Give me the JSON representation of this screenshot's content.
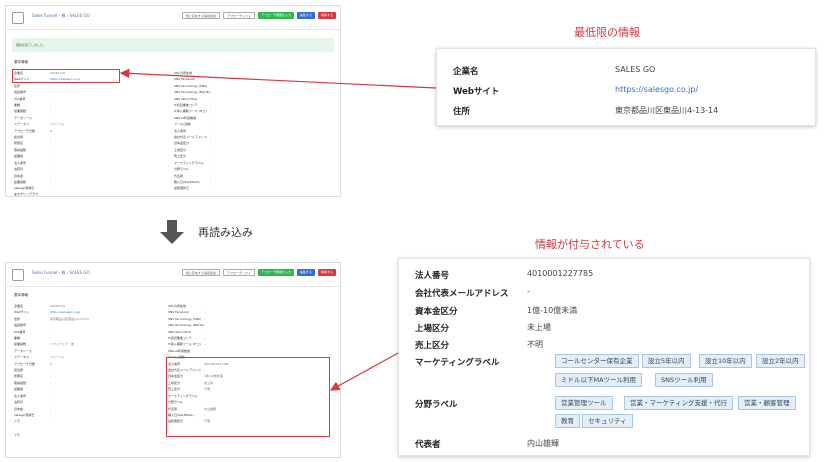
{
  "top_shot": {
    "crumb": "Sales Funnel › 株 › SALES GO",
    "buttons": [
      "既に存在する情報追加",
      "アプローチリスト",
      "アプローチ履歴を入力",
      "編集する",
      "削除する"
    ],
    "alert": "保存が完了しました。",
    "section": "基本情報",
    "left_rows": [
      [
        "企業名",
        "SALES GO"
      ],
      [
        "Webサイト",
        "https://salesgo.co.jp"
      ],
      [
        "住所",
        "-"
      ],
      [
        "電話番号",
        "-"
      ],
      [
        "FAX番号",
        "-"
      ],
      [
        "業種",
        "-"
      ],
      [
        "従業員数",
        "-"
      ],
      [
        "データソース",
        "-"
      ],
      [
        "ステータス",
        "フリー(ミ)"
      ],
      [
        "アプローチ日数",
        "0"
      ],
      [
        "担当者",
        "-"
      ],
      [
        "所属名",
        "-"
      ],
      [
        "取締役数",
        "-"
      ],
      [
        "従業員",
        "-"
      ],
      [
        "法人番号",
        "-"
      ],
      [
        "決算月",
        "-"
      ],
      [
        "資本金",
        "-"
      ],
      [
        "従業員数",
        "-"
      ],
      [
        "salesgo登録日",
        "-"
      ],
      [
        "メモ",
        "-"
      ]
    ],
    "right_rows": [
      [
        "URLの所在地",
        "-"
      ],
      [
        "SNS Facebook",
        "-"
      ],
      [
        "SNS Technology (SNS)",
        "-"
      ],
      [
        "SNS Technology (MarTe)",
        "-"
      ],
      [
        "SNS Yahoo/Hub",
        "-"
      ],
      [
        "IT投資推進コンテ",
        "-"
      ],
      [
        "IT導入補助ツール (ITコ)",
        "-"
      ],
      [
        "SNS-AI利用推進",
        "-"
      ],
      [
        "ツール(活動)",
        "-"
      ],
      [
        "法人番号",
        "-"
      ],
      [
        "会社代表メールアドレス",
        "-"
      ],
      [
        "資本金区分",
        "-"
      ],
      [
        "上場区分",
        "-"
      ],
      [
        "売上区分",
        "-"
      ],
      [
        "マーケティングラベル",
        "-"
      ],
      [
        "分野ラベル",
        "-"
      ],
      [
        "代表者",
        "-"
      ],
      [
        "購入日(SALESGO)",
        "-"
      ],
      [
        "最終更新日",
        "-"
      ]
    ],
    "footer": "オーダリングラマ"
  },
  "bottom_shot": {
    "crumb": "Sales Funnel › 株 › SALES GO",
    "buttons": [
      "既に存在する情報追加",
      "アプローチリスト",
      "アプローチ履歴を入力",
      "編集する",
      "削除する"
    ],
    "section": "基本情報",
    "left_rows": [
      [
        "企業名",
        "SALES GO"
      ],
      [
        "Webサイト",
        "https://salesgo.co.jp"
      ],
      [
        "住所",
        "東京都品川区東品川4-13-14"
      ],
      [
        "電話番号",
        "-"
      ],
      [
        "FAX番号",
        "-"
      ],
      [
        "業種",
        "-"
      ],
      [
        "従業員数",
        "ソフトウェア・他"
      ],
      [
        "データソース",
        "-"
      ],
      [
        "ステータス",
        "フリー(ミ)"
      ],
      [
        "アプローチ日数",
        "0"
      ],
      [
        "担当者",
        "-"
      ],
      [
        "所属名",
        "-"
      ],
      [
        "取締役数",
        "-"
      ],
      [
        "従業員",
        "-"
      ],
      [
        "法人番号",
        "-"
      ],
      [
        "決算月",
        "-"
      ],
      [
        "資本金",
        "-"
      ],
      [
        "salesgo登録日",
        "-"
      ],
      [
        "メモ",
        "-"
      ]
    ],
    "right_rows": [
      [
        "URLの所在地",
        "-"
      ],
      [
        "SNS Facebook",
        "-"
      ],
      [
        "SNS Technology (SNS)",
        "-"
      ],
      [
        "SNS Technology (MarTe)",
        "-"
      ],
      [
        "SNS Yahoo/Hub",
        "-"
      ],
      [
        "IT投資推進コンテ",
        "-"
      ],
      [
        "IT導入補助ツール (ITコ)",
        "-"
      ],
      [
        "SNS-AI利用推進",
        "-"
      ],
      [
        "ツール(活動)",
        "-"
      ],
      [
        "法人番号",
        "4010001227785"
      ],
      [
        "会社代表メールアドレス",
        "-"
      ],
      [
        "資本金区分",
        "1億-10億未満"
      ],
      [
        "上場区分",
        "未上場"
      ],
      [
        "売上区分",
        "不明"
      ],
      [
        "マーケティングラベル",
        ""
      ],
      [
        "",
        ""
      ],
      [
        "",
        ""
      ],
      [
        "分野ラベル",
        ""
      ],
      [
        "",
        ""
      ],
      [
        "代表者",
        "内山雄輝"
      ],
      [
        "購入日(SALESGO)",
        "-"
      ],
      [
        "最終更新日",
        "不明"
      ]
    ],
    "footer": "メモ"
  },
  "reload_label": "再読み込み",
  "min_info": {
    "title": "最低限の情報",
    "rows": [
      {
        "label": "企業名",
        "value": "SALES GO"
      },
      {
        "label": "Webサイト",
        "value": "https://salesgo.co.jp/"
      },
      {
        "label": "住所",
        "value": "東京都品川区東品川4-13-14"
      }
    ]
  },
  "added_info": {
    "title": "情報が付与されている",
    "rows": [
      {
        "label": "法人番号",
        "value": "4010001227785"
      },
      {
        "label": "会社代表メールアドレス",
        "value": "-"
      },
      {
        "label": "資本金区分",
        "value": "1億-10億未満"
      },
      {
        "label": "上場区分",
        "value": "未上場"
      },
      {
        "label": "売上区分",
        "value": "不明"
      },
      {
        "label": "マーケティングラベル",
        "value": ""
      },
      {
        "label": "分野ラベル",
        "value": ""
      },
      {
        "label": "代表者",
        "value": "内山雄輝"
      }
    ],
    "marketing_tags": [
      "コールセンター保有企業",
      "設立5年以内",
      "設立10年以内",
      "設立2年以内",
      "ミドル以下MAツール利用",
      "SNSツール利用"
    ],
    "field_tags": [
      "営業管理ツール",
      "営業・マーケティング支援・代行",
      "営業・顧客管理",
      "教育",
      "セキュリティ"
    ]
  },
  "colors": {
    "accent_red": "#d9363e",
    "link_blue": "#2f6fd6",
    "tag_bg": "#e3eef8"
  }
}
